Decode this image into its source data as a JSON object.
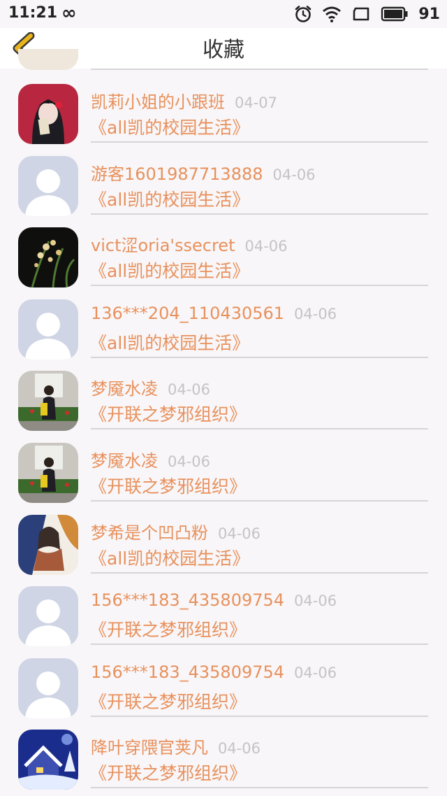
{
  "status_bar": {
    "time": "11:21",
    "battery": "91"
  },
  "header": {
    "title": "收藏"
  },
  "items": [
    {
      "user": "凯莉小姐的小跟班",
      "date": "04-07",
      "book": "《all凯的校园生活》",
      "avatar": "anime-girl-avatar"
    },
    {
      "user": "游客1601987713888",
      "date": "04-06",
      "book": "《all凯的校园生活》",
      "avatar": "default-user-avatar"
    },
    {
      "user": "vict涩oria'ssecret",
      "date": "04-06",
      "book": "《all凯的校园生活》",
      "avatar": "orchid-avatar"
    },
    {
      "user": "136***204_110430561",
      "date": "04-06",
      "book": "《all凯的校园生活》",
      "avatar": "default-user-avatar"
    },
    {
      "user": "梦魇水凌",
      "date": "04-06",
      "book": "《开联之梦邪组织》",
      "avatar": "photo-person-avatar"
    },
    {
      "user": "梦魇水凌",
      "date": "04-06",
      "book": "《开联之梦邪组织》",
      "avatar": "photo-person-avatar"
    },
    {
      "user": "梦希是个凹凸粉",
      "date": "04-06",
      "book": "《all凯的校园生活》",
      "avatar": "anime-illustration-avatar"
    },
    {
      "user": "156***183_435809754",
      "date": "04-06",
      "book": "《开联之梦邪组织》",
      "avatar": "default-user-avatar"
    },
    {
      "user": "156***183_435809754",
      "date": "04-06",
      "book": "《开联之梦邪组织》",
      "avatar": "default-user-avatar"
    },
    {
      "user": "降叶穿隈官荚凡",
      "date": "04-06",
      "book": "《开联之梦邪组织》",
      "avatar": "snow-house-avatar"
    }
  ],
  "colors": {
    "accent": "#e8915d",
    "date": "#c4c4c4",
    "back_icon": "#e9b50c",
    "divider": "#d6d6d6"
  }
}
